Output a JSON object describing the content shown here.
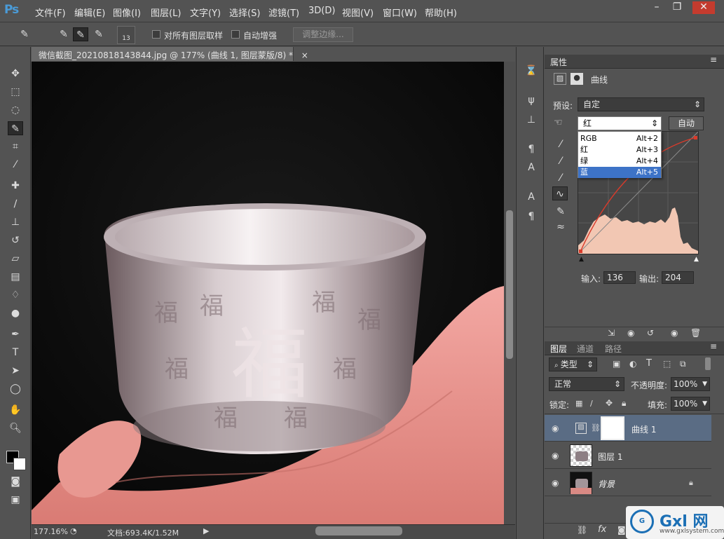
{
  "app": {
    "logo": "Ps"
  },
  "menu": [
    "文件(F)",
    "编辑(E)",
    "图像(I)",
    "图层(L)",
    "文字(Y)",
    "选择(S)",
    "滤镜(T)",
    "3D(D)",
    "视图(V)",
    "窗口(W)",
    "帮助(H)"
  ],
  "window_controls": {
    "minimize": "–",
    "restore": "❐",
    "close": "✕"
  },
  "options": {
    "brush_size": "13",
    "sample_all_layers": "对所有图层取样",
    "auto_enhance": "自动增强",
    "refine_edge": "调整边缘..."
  },
  "document": {
    "tab_title": "微信截图_20210818143844.jpg @ 177% (曲线 1, 图层蒙版/8) *",
    "tab_close": "×",
    "zoom": "177.16%",
    "doc_size": "文档:693.4K/1.52M"
  },
  "properties": {
    "tab": "属性",
    "title": "曲线",
    "preset_label": "预设:",
    "preset_value": "自定",
    "channel_value": "红",
    "auto_button": "自动",
    "channel_options": [
      {
        "name": "RGB",
        "shortcut": "Alt+2"
      },
      {
        "name": "红",
        "shortcut": "Alt+3"
      },
      {
        "name": "绿",
        "shortcut": "Alt+4"
      },
      {
        "name": "蓝",
        "shortcut": "Alt+5"
      }
    ],
    "input_label": "输入:",
    "input_value": "136",
    "output_label": "输出:",
    "output_value": "204"
  },
  "layers": {
    "tabs": [
      "图层",
      "通道",
      "路径"
    ],
    "filter_label": "类型",
    "blend_mode": "正常",
    "opacity_label": "不透明度:",
    "opacity_value": "100%",
    "lock_label": "锁定:",
    "fill_label": "填充:",
    "fill_value": "100%",
    "items": [
      {
        "name": "曲线 1"
      },
      {
        "name": "图层 1"
      },
      {
        "name": "背景"
      }
    ]
  },
  "watermark": {
    "brand": "Gxl 网",
    "url": "www.gxlsystem.com"
  },
  "colors": {
    "accent": "#3d73c7",
    "background": "#535353",
    "curve": "#d93b2b",
    "histogram": "#f2c7b3"
  }
}
